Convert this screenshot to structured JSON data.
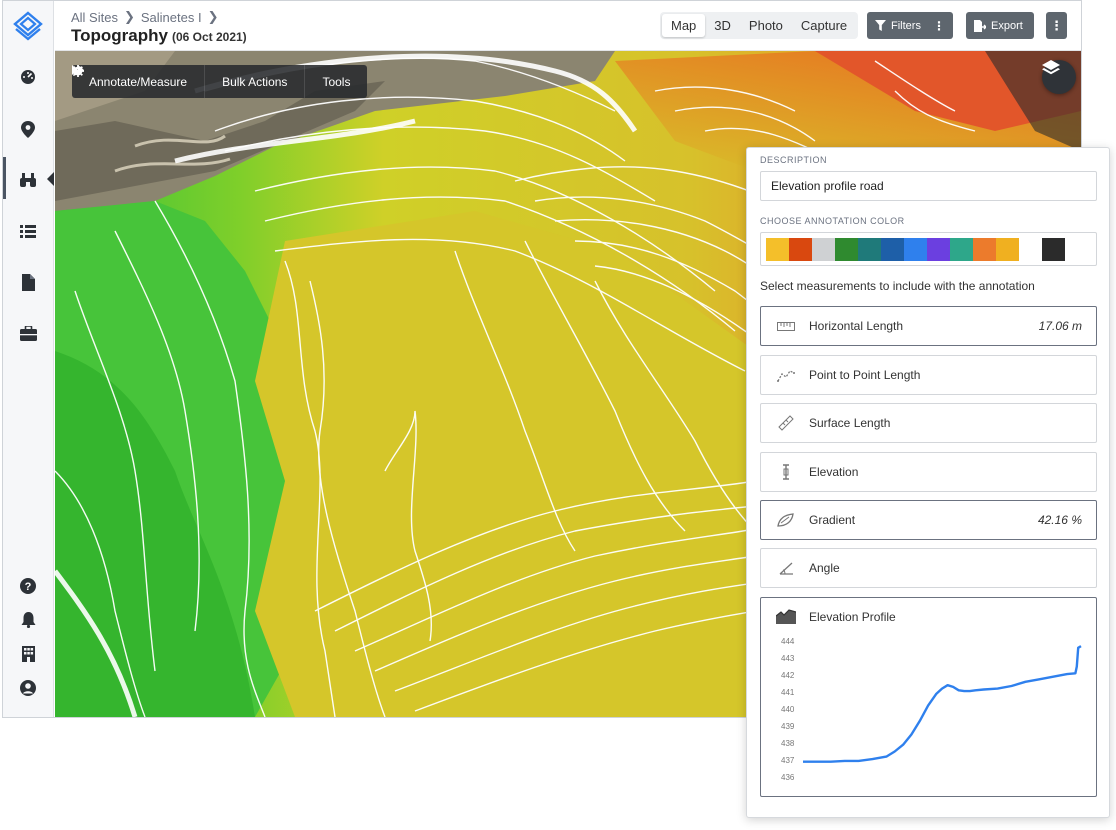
{
  "breadcrumb": {
    "items": [
      "All Sites",
      "Salinetes I"
    ]
  },
  "page": {
    "title": "Topography",
    "date": "(06 Oct 2021)"
  },
  "view_tabs": [
    {
      "label": "Map",
      "active": true
    },
    {
      "label": "3D",
      "active": false
    },
    {
      "label": "Photo",
      "active": false
    },
    {
      "label": "Capture",
      "active": false
    }
  ],
  "header_buttons": {
    "filters": "Filters",
    "export": "Export"
  },
  "map_toolbar": {
    "annotate": "Annotate/Measure",
    "bulk": "Bulk Actions",
    "tools": "Tools"
  },
  "sidebar": {
    "icons": [
      "dashboard-icon",
      "location-pin-icon",
      "binoculars-icon",
      "list-icon",
      "document-icon",
      "briefcase-icon",
      "help-icon",
      "bell-icon",
      "building-icon",
      "user-icon"
    ]
  },
  "panel": {
    "description_label": "DESCRIPTION",
    "description_value": "Elevation profile road",
    "color_label": "CHOOSE ANNOTATION COLOR",
    "colors": [
      "#f4bf2a",
      "#d9480f",
      "#cfd1d3",
      "#2f8a2f",
      "#1f7a7a",
      "#1e5fa8",
      "#2f80ed",
      "#6b3fe0",
      "#2ea78a",
      "#ec7b2c",
      "#f0b020",
      "#ffffff",
      "#2b2b2b"
    ],
    "measure_hint": "Select measurements to include with the annotation",
    "measurements": [
      {
        "label": "Horizontal Length",
        "value": "17.06 m",
        "selected": true,
        "icon": "ruler-icon"
      },
      {
        "label": "Point to Point Length",
        "value": "",
        "selected": false,
        "icon": "zigzag-line-icon"
      },
      {
        "label": "Surface Length",
        "value": "",
        "selected": false,
        "icon": "diagonal-ruler-icon"
      },
      {
        "label": "Elevation",
        "value": "",
        "selected": false,
        "icon": "elevation-icon"
      },
      {
        "label": "Gradient",
        "value": "42.16 %",
        "selected": true,
        "icon": "gradient-icon"
      },
      {
        "label": "Angle",
        "value": "",
        "selected": false,
        "icon": "angle-icon"
      }
    ],
    "profile_title": "Elevation Profile"
  },
  "chart_data": {
    "type": "line",
    "title": "",
    "xlabel": "",
    "ylabel": "",
    "ylim": [
      436,
      444
    ],
    "yticks": [
      444,
      443,
      442,
      441,
      440,
      439,
      438,
      437,
      436
    ],
    "series": [
      {
        "color": "#2f80ed",
        "x": [
          0,
          0.05,
          0.1,
          0.15,
          0.2,
          0.25,
          0.3,
          0.33,
          0.36,
          0.39,
          0.42,
          0.45,
          0.48,
          0.5,
          0.52,
          0.54,
          0.56,
          0.58,
          0.6,
          0.62,
          0.65,
          0.7,
          0.75,
          0.8,
          0.85,
          0.9,
          0.95,
          0.98,
          0.985,
          0.99,
          1.0
        ],
        "values": [
          436.9,
          436.9,
          436.9,
          436.95,
          436.95,
          437.05,
          437.2,
          437.5,
          437.9,
          438.5,
          439.3,
          440.2,
          440.9,
          441.2,
          441.4,
          441.3,
          441.1,
          441.05,
          441.05,
          441.1,
          441.15,
          441.2,
          441.35,
          441.6,
          441.75,
          441.9,
          442.05,
          442.1,
          442.5,
          443.6,
          443.7
        ]
      }
    ]
  }
}
